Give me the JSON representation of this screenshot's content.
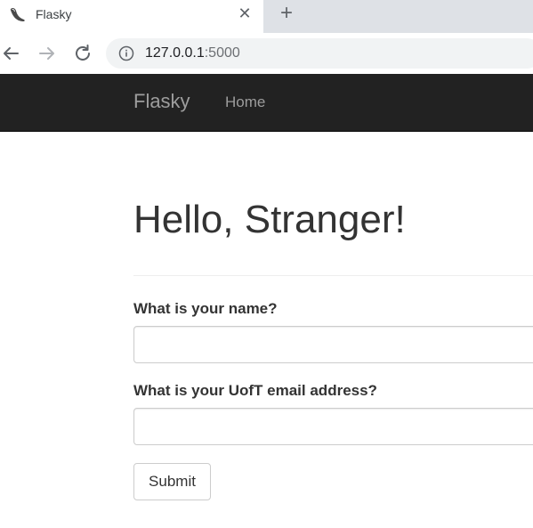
{
  "browser": {
    "tab_title": "Flasky",
    "tab_close_glyph": "✕",
    "new_tab_glyph": "+",
    "url_host": "127.0.0.1",
    "url_port": ":5000",
    "icons": {
      "favicon": "flask-horn-icon",
      "back": "arrow-left-icon",
      "forward": "arrow-right-icon",
      "reload": "reload-icon",
      "info": "info-icon"
    }
  },
  "navbar": {
    "brand": "Flasky",
    "links": [
      {
        "label": "Home"
      }
    ]
  },
  "main": {
    "title": "Hello, Stranger!",
    "form": {
      "name_label": "What is your name?",
      "name_value": "",
      "email_label": "What is your UofT email address?",
      "email_value": "",
      "submit_label": "Submit"
    }
  },
  "colors": {
    "navbar_bg": "#222222",
    "navbar_text": "#9d9d9d",
    "text": "#333333",
    "input_border": "#cccccc"
  }
}
